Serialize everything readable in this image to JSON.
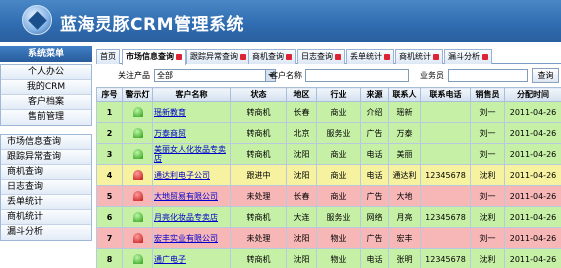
{
  "app": {
    "title": "蓝海灵豚CRM管理系统"
  },
  "sidebar": {
    "title": "系统菜单",
    "items": [
      "个人办公",
      "我的CRM",
      "客户档案",
      "售前管理"
    ],
    "sub_items": [
      "市场信息查询",
      "跟踪异常查询",
      "商机查询",
      "日志查询",
      "丢单统计",
      "商机统计",
      "漏斗分析"
    ]
  },
  "tabs": [
    {
      "label": "首页",
      "closable": false
    },
    {
      "label": "市场信息查询",
      "closable": true,
      "active": true
    },
    {
      "label": "跟踪异常查询",
      "closable": true
    },
    {
      "label": "商机查询",
      "closable": true
    },
    {
      "label": "日志查询",
      "closable": true
    },
    {
      "label": "丢单统计",
      "closable": true
    },
    {
      "label": "商机统计",
      "closable": true
    },
    {
      "label": "漏斗分析",
      "closable": true
    }
  ],
  "filter": {
    "product_label": "关注产品",
    "product_value": "全部",
    "customer_label": "客户名称",
    "customer_value": "",
    "sales_label": "业务员",
    "sales_value": "",
    "search_button": "查询"
  },
  "table": {
    "headers": [
      "序号",
      "警示灯",
      "客户名称",
      "状态",
      "地区",
      "行业",
      "来源",
      "联系人",
      "联系电话",
      "销售员",
      "分配时间"
    ],
    "rows": [
      {
        "idx": "1",
        "light": "green",
        "row_color": "green",
        "name": "瑶新教育",
        "status": "转商机",
        "region": "长春",
        "industry": "商业",
        "source": "介绍",
        "contact": "瑶新",
        "phone": "",
        "sales": "刘一",
        "date": "2011-04-26"
      },
      {
        "idx": "2",
        "light": "green",
        "row_color": "green",
        "name": "万泰商贸",
        "status": "转商机",
        "region": "北京",
        "industry": "服务业",
        "source": "广告",
        "contact": "万泰",
        "phone": "",
        "sales": "刘一",
        "date": "2011-04-26"
      },
      {
        "idx": "3",
        "light": "green",
        "row_color": "green",
        "name": "美丽女人化妆品专卖店",
        "status": "转商机",
        "region": "沈阳",
        "industry": "商业",
        "source": "电话",
        "contact": "美丽",
        "phone": "",
        "sales": "刘一",
        "date": "2011-04-26"
      },
      {
        "idx": "4",
        "light": "red",
        "row_color": "yellow",
        "name": "通达利电子公司",
        "status": "跟进中",
        "region": "沈阳",
        "industry": "商业",
        "source": "电话",
        "contact": "通达利",
        "phone": "12345678",
        "sales": "沈利",
        "date": "2011-04-26"
      },
      {
        "idx": "5",
        "light": "red",
        "row_color": "red",
        "name": "大地贸易有限公司",
        "status": "未处理",
        "region": "长春",
        "industry": "商业",
        "source": "广告",
        "contact": "大地",
        "phone": "",
        "sales": "刘一",
        "date": "2011-04-26"
      },
      {
        "idx": "6",
        "light": "green",
        "row_color": "green",
        "name": "月亮化妆品专卖店",
        "status": "转商机",
        "region": "大连",
        "industry": "服务业",
        "source": "网络",
        "contact": "月亮",
        "phone": "12345678",
        "sales": "沈利",
        "date": "2011-04-26"
      },
      {
        "idx": "7",
        "light": "red",
        "row_color": "red",
        "name": "宏丰实业有限公司",
        "status": "未处理",
        "region": "沈阳",
        "industry": "物业",
        "source": "广告",
        "contact": "宏丰",
        "phone": "",
        "sales": "刘一",
        "date": "2011-04-26"
      },
      {
        "idx": "8",
        "light": "green",
        "row_color": "green",
        "name": "通广电子",
        "status": "转商机",
        "region": "沈阳",
        "industry": "物业",
        "source": "电话",
        "contact": "张明",
        "phone": "12345678",
        "sales": "沈利",
        "date": "2011-04-26"
      }
    ]
  }
}
